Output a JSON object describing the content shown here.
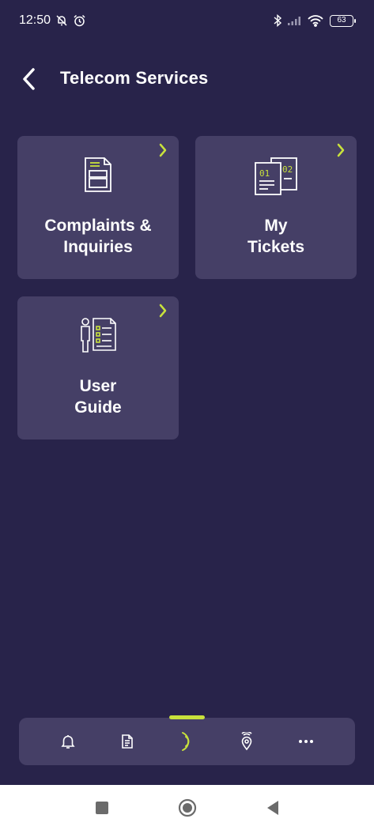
{
  "status_bar": {
    "time": "12:50",
    "battery": "63",
    "icons": [
      "bell-off-icon",
      "alarm-icon",
      "bluetooth-icon",
      "signal-icon",
      "wifi-icon",
      "battery-icon"
    ]
  },
  "header": {
    "title": "Telecom Services",
    "back_icon": "back-arrow-icon"
  },
  "cards": [
    {
      "line1": "Complaints &",
      "line2": "Inquiries",
      "icon": "form-document-icon"
    },
    {
      "line1": "My",
      "line2": "Tickets",
      "icon": "tickets-icon"
    },
    {
      "line1": "User",
      "line2": "Guide",
      "icon": "user-guide-icon"
    }
  ],
  "bottom_nav": {
    "items": [
      "notifications-bell-icon",
      "document-icon",
      "signal-wave-icon",
      "location-signal-icon",
      "more-dots-icon"
    ],
    "active_index": 2
  },
  "system_nav": {
    "items": [
      "recents-square-icon",
      "home-circle-icon",
      "back-triangle-icon"
    ]
  },
  "colors": {
    "background": "#28234a",
    "card": "#453f66",
    "accent": "#c8e13c",
    "text": "#ffffff"
  }
}
